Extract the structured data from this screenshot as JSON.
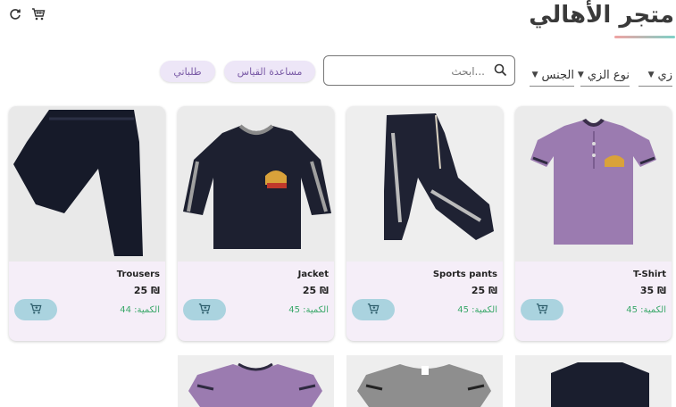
{
  "header": {
    "title": "متجر الأهالي",
    "refresh_icon": "refresh-icon",
    "cart_icon": "cart-icon"
  },
  "filters": {
    "uniform": "زي",
    "uniform_type": "نوع الزي",
    "gender": "الجنس",
    "search_placeholder": "ابحث...",
    "size_help": "مساعدة القياس",
    "my_orders": "طلباتي"
  },
  "products": [
    {
      "name": "T-Shirt",
      "price": "₪ 35",
      "qty": "الكمية: 45"
    },
    {
      "name": "Sports pants",
      "price": "₪ 25",
      "qty": "الكمية: 45"
    },
    {
      "name": "Jacket",
      "price": "₪ 25",
      "qty": "الكمية: 45"
    },
    {
      "name": "Trousers",
      "price": "₪ 25",
      "qty": "الكمية: 44"
    }
  ],
  "colors": {
    "card_bg": "#f5eef8",
    "cart_button": "#aad3df",
    "qty_text": "#3aa86a",
    "pill_bg": "#ede6f7"
  }
}
